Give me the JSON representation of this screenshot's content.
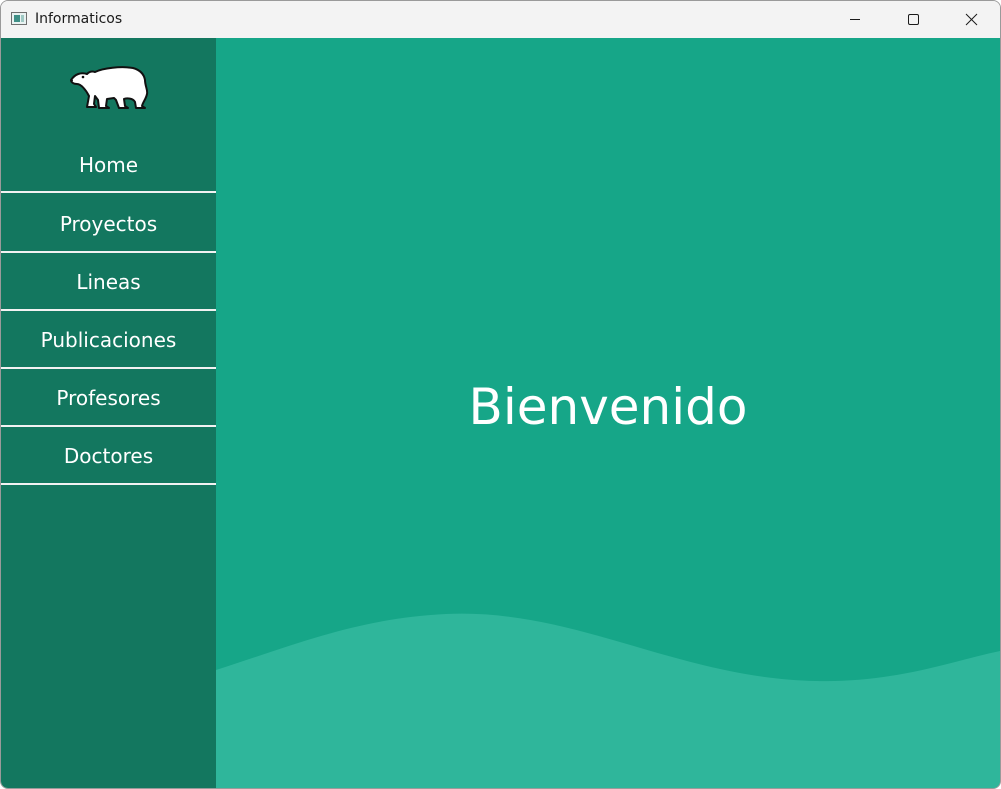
{
  "window": {
    "title": "Informaticos",
    "controls": {
      "minimize": "minimize-icon",
      "maximize": "maximize-icon",
      "close": "close-icon"
    }
  },
  "sidebar": {
    "logo": "polar-bear-icon",
    "items": [
      {
        "label": "Home"
      },
      {
        "label": "Proyectos"
      },
      {
        "label": "Lineas"
      },
      {
        "label": "Publicaciones"
      },
      {
        "label": "Profesores"
      },
      {
        "label": "Doctores"
      }
    ]
  },
  "main": {
    "welcome": "Bienvenido"
  },
  "colors": {
    "sidebar_bg": "#13775f",
    "main_bg": "#16a688",
    "wave": "#2fb69b",
    "divider": "#f2f2f2",
    "titlebar": "#f3f3f3"
  }
}
